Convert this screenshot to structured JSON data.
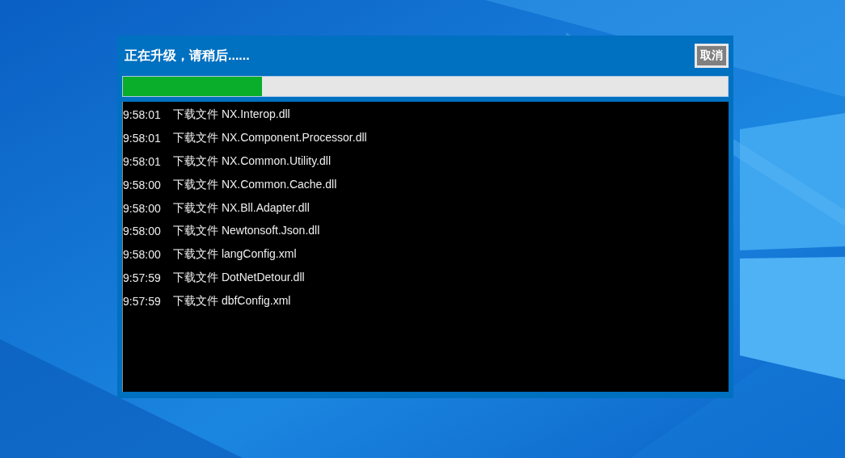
{
  "dialog": {
    "title": "正在升级，请稍后......",
    "cancel_button": "取消",
    "progress": {
      "level": 0.23
    }
  },
  "log": [
    {
      "time": "9:58:01",
      "message": "下载文件 NX.Interop.dll"
    },
    {
      "time": "9:58:01",
      "message": "下载文件 NX.Component.Processor.dll"
    },
    {
      "time": "9:58:01",
      "message": "下载文件 NX.Common.Utility.dll"
    },
    {
      "time": "9:58:00",
      "message": "下载文件 NX.Common.Cache.dll"
    },
    {
      "time": "9:58:00",
      "message": "下载文件 NX.Bll.Adapter.dll"
    },
    {
      "time": "9:58:00",
      "message": "下载文件 Newtonsoft.Json.dll"
    },
    {
      "time": "9:58:00",
      "message": "下载文件 langConfig.xml"
    },
    {
      "time": "9:57:59",
      "message": "下载文件 DotNetDetour.dll"
    },
    {
      "time": "9:57:59",
      "message": "下载文件 dbfConfig.xml"
    }
  ]
}
